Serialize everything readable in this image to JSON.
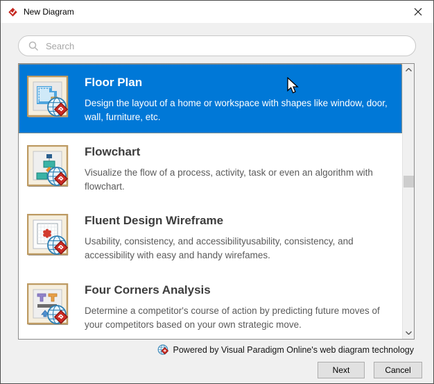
{
  "window": {
    "title": "New Diagram"
  },
  "search": {
    "placeholder": "Search"
  },
  "list": {
    "items": [
      {
        "title": "Floor Plan",
        "description": "Design the layout of a home or workspace with shapes like window, door, wall, furniture, etc.",
        "selected": true,
        "icon": "floor-plan-icon"
      },
      {
        "title": "Flowchart",
        "description": "Visualize the flow of a process, activity, task or even an algorithm with flowchart.",
        "selected": false,
        "icon": "flowchart-icon"
      },
      {
        "title": "Fluent Design Wireframe",
        "description": "Usability, consistency, and accessibilityusability, consistency, and accessibility with easy and handy wirefames.",
        "selected": false,
        "icon": "fluent-design-wireframe-icon"
      },
      {
        "title": "Four Corners Analysis",
        "description": "Determine a competitor's course of action by predicting future moves of your competitors based on your own strategic move.",
        "selected": false,
        "icon": "four-corners-analysis-icon"
      }
    ]
  },
  "footer": {
    "powered_by": "Powered by Visual Paradigm Online's web diagram technology",
    "buttons": {
      "next": "Next",
      "cancel": "Cancel"
    }
  },
  "colors": {
    "selection_background": "#0078d7",
    "selection_focus_border": "#f0a14b",
    "window_background": "#f0f0f0",
    "titlebar_background": "#ffffff",
    "brand_red": "#c5271f",
    "button_background": "#e1e1e1"
  }
}
